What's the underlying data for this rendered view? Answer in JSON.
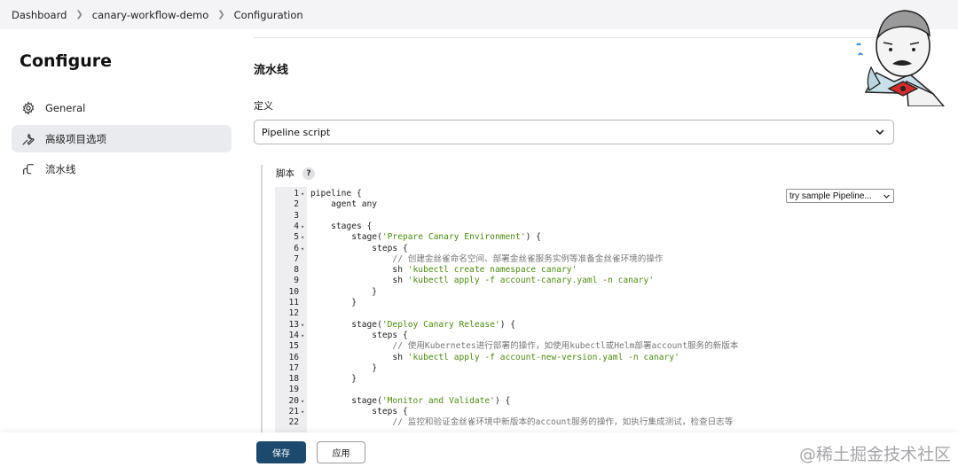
{
  "breadcrumb": [
    "Dashboard",
    "canary-workflow-demo",
    "Configuration"
  ],
  "sidebar": {
    "title": "Configure",
    "items": [
      {
        "label": "General",
        "icon": "gear-icon",
        "active": false
      },
      {
        "label": "高级项目选项",
        "icon": "wrench-icon",
        "active": true
      },
      {
        "label": "流水线",
        "icon": "pipeline-icon",
        "active": false
      }
    ]
  },
  "main": {
    "section_title": "流水线",
    "definition_label": "定义",
    "definition_value": "Pipeline script",
    "script_label": "脚本",
    "help_symbol": "?",
    "sample_select": "try sample Pipeline..."
  },
  "code_lines": [
    {
      "n": "1",
      "fold": true,
      "segs": [
        [
          "t",
          "pipeline {"
        ]
      ]
    },
    {
      "n": "2",
      "fold": false,
      "segs": [
        [
          "t",
          "    agent any"
        ]
      ]
    },
    {
      "n": "3",
      "fold": false,
      "segs": [
        [
          "t",
          ""
        ]
      ]
    },
    {
      "n": "4",
      "fold": true,
      "segs": [
        [
          "t",
          "    stages {"
        ]
      ]
    },
    {
      "n": "5",
      "fold": true,
      "segs": [
        [
          "t",
          "        stage("
        ],
        [
          "s",
          "'Prepare Canary Environment'"
        ],
        [
          "t",
          ") {"
        ]
      ]
    },
    {
      "n": "6",
      "fold": true,
      "segs": [
        [
          "t",
          "            steps {"
        ]
      ]
    },
    {
      "n": "7",
      "fold": false,
      "segs": [
        [
          "c",
          "                // 创建金丝雀命名空间、部署金丝雀服务实例等准备金丝雀环境的操作"
        ]
      ]
    },
    {
      "n": "8",
      "fold": false,
      "segs": [
        [
          "t",
          "                sh "
        ],
        [
          "s",
          "'kubectl create namespace canary'"
        ]
      ]
    },
    {
      "n": "9",
      "fold": false,
      "segs": [
        [
          "t",
          "                sh "
        ],
        [
          "s",
          "'kubectl apply -f account-canary.yaml -n canary'"
        ]
      ]
    },
    {
      "n": "10",
      "fold": false,
      "segs": [
        [
          "t",
          "            }"
        ]
      ]
    },
    {
      "n": "11",
      "fold": false,
      "segs": [
        [
          "t",
          "        }"
        ]
      ]
    },
    {
      "n": "12",
      "fold": false,
      "segs": [
        [
          "t",
          ""
        ]
      ]
    },
    {
      "n": "13",
      "fold": true,
      "segs": [
        [
          "t",
          "        stage("
        ],
        [
          "s",
          "'Deploy Canary Release'"
        ],
        [
          "t",
          ") {"
        ]
      ]
    },
    {
      "n": "14",
      "fold": true,
      "segs": [
        [
          "t",
          "            steps {"
        ]
      ]
    },
    {
      "n": "15",
      "fold": false,
      "segs": [
        [
          "c",
          "                // 使用Kubernetes进行部署的操作，如使用kubectl或Helm部署account服务的新版本"
        ]
      ]
    },
    {
      "n": "16",
      "fold": false,
      "segs": [
        [
          "t",
          "                sh "
        ],
        [
          "s",
          "'kubectl apply -f account-new-version.yaml -n canary'"
        ]
      ]
    },
    {
      "n": "17",
      "fold": false,
      "segs": [
        [
          "t",
          "            }"
        ]
      ]
    },
    {
      "n": "18",
      "fold": false,
      "segs": [
        [
          "t",
          "        }"
        ]
      ]
    },
    {
      "n": "19",
      "fold": false,
      "segs": [
        [
          "t",
          ""
        ]
      ]
    },
    {
      "n": "20",
      "fold": true,
      "segs": [
        [
          "t",
          "        stage("
        ],
        [
          "s",
          "'Monitor and Validate'"
        ],
        [
          "t",
          ") {"
        ]
      ]
    },
    {
      "n": "21",
      "fold": true,
      "segs": [
        [
          "t",
          "            steps {"
        ]
      ]
    },
    {
      "n": "22",
      "fold": false,
      "segs": [
        [
          "c",
          "                // 监控和验证金丝雀环境中新版本的account服务的操作，如执行集成测试，检查日志等"
        ]
      ]
    }
  ],
  "footer": {
    "save_label": "保存",
    "apply_label": "应用",
    "watermark": "@稀土掘金技术社区"
  },
  "colors": {
    "save_bg": "#1c4a6e",
    "string": "#4f8a10",
    "comment": "#777777",
    "active_sidebar": "#e9ebef"
  }
}
